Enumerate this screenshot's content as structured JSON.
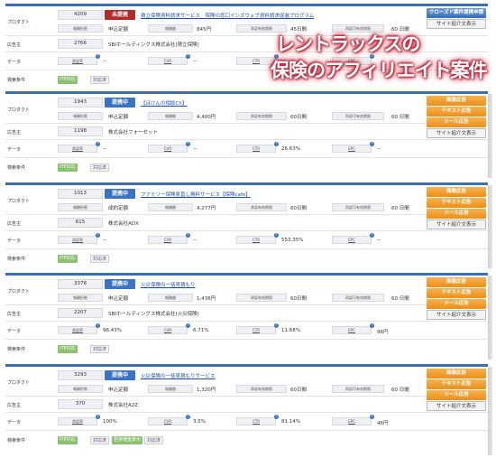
{
  "labels": {
    "product": "プロダクト",
    "advertiser": "広告主",
    "data": "データ",
    "search": "検索条件",
    "reward_type": "報酬形態",
    "reward_amount": "報酬額",
    "approval_period": "承認有効期限",
    "reissue_period": "再認可有効期限",
    "approval_rate": "承認率",
    "cvr": "CVR",
    "ctr": "CTR",
    "epc": "EPC"
  },
  "overlay": {
    "line1": "レントラックスの",
    "line2": "保険のアフィリエイト案件"
  },
  "cards": [
    {
      "id": "4209",
      "status": "未提携",
      "status_color": "red",
      "title": "積立保険資料請求サービス　保険の窓口インズウェブ資料請求促進プログラム",
      "reward_type": "申込定額",
      "reward": "845円",
      "approval": "45日間",
      "reissue": "60 日間",
      "adv_id": "2766",
      "adv_name": "SBIホールディングス株式会社(積立保険)",
      "rate": "--",
      "cvr": "--",
      "ctr": "--",
      "epc": "",
      "tags": [
        "ITP対応",
        "対応済"
      ],
      "buttons": [
        {
          "label": "クローズド案件提携申請",
          "color": "blue"
        },
        {
          "label": "サイト紹介文表示",
          "color": "white"
        }
      ]
    },
    {
      "id": "1943",
      "status": "提携中",
      "status_color": "blue",
      "title": "【ほけんの相談Ch】",
      "reward_type": "申込定額",
      "reward": "4,400円",
      "approval": "60日間",
      "reissue": "60 日間",
      "adv_id": "1198",
      "adv_name": "株式会社フォーセット",
      "rate": "--",
      "cvr": "--",
      "ctr": "26.63%",
      "epc": "--",
      "tags": [
        "ITP対応",
        "対応済"
      ],
      "buttons": [
        {
          "label": "画像広告",
          "color": "orange"
        },
        {
          "label": "テキスト広告",
          "color": "orange"
        },
        {
          "label": "メール広告",
          "color": "orange"
        },
        {
          "label": "サイト紹介文表示",
          "color": "white"
        }
      ]
    },
    {
      "id": "1013",
      "status": "提携中",
      "status_color": "blue",
      "title": "ファミリー保険見直し無料サービス【保険cafe】",
      "reward_type": "成約定額",
      "reward": "4,277円",
      "approval": "60日間",
      "reissue": "60 日間",
      "adv_id": "615",
      "adv_name": "株式会社ADX",
      "rate": "--",
      "cvr": "--",
      "ctr": "553.35%",
      "epc": "--",
      "tags": [
        "ITP対応",
        "対応済"
      ],
      "buttons": [
        {
          "label": "画像広告",
          "color": "orange"
        },
        {
          "label": "テキスト広告",
          "color": "orange"
        },
        {
          "label": "メール広告",
          "color": "orange"
        },
        {
          "label": "サイト紹介文表示",
          "color": "white"
        }
      ]
    },
    {
      "id": "3378",
      "status": "提携中",
      "status_color": "blue",
      "title": "火災保険の一括見積もり",
      "reward_type": "申込定額",
      "reward": "1,436円",
      "approval": "60日間",
      "reissue": "60 日間",
      "adv_id": "2207",
      "adv_name": "SBIホールディングス株式会社(火災保険)",
      "rate": "96.43%",
      "cvr": "6.71%",
      "ctr": "11.68%",
      "epc": "96円",
      "tags": [
        "ITP対応",
        "対応済"
      ],
      "buttons": [
        {
          "label": "画像広告",
          "color": "orange"
        },
        {
          "label": "テキスト広告",
          "color": "orange"
        },
        {
          "label": "メール広告",
          "color": "orange"
        },
        {
          "label": "サイト紹介文表示",
          "color": "white"
        }
      ]
    },
    {
      "id": "3293",
      "status": "提携中",
      "status_color": "blue",
      "title": "火災保険の一括見積もりサービス",
      "reward_type": "申込定額",
      "reward": "1,320円",
      "approval": "60日間",
      "reissue": "60 日間",
      "adv_id": "370",
      "adv_name": "株式会社A2Z",
      "rate": "100%",
      "cvr": "3.5%",
      "ctr": "81.14%",
      "epc": "46円",
      "tags": [
        "ITP対応",
        "対応済",
        "若芽増金表示",
        "対応済"
      ],
      "buttons": [
        {
          "label": "画像広告",
          "color": "orange"
        },
        {
          "label": "テキスト広告",
          "color": "orange"
        },
        {
          "label": "メール広告",
          "color": "orange"
        },
        {
          "label": "サイト紹介文表示",
          "color": "white"
        }
      ]
    }
  ]
}
